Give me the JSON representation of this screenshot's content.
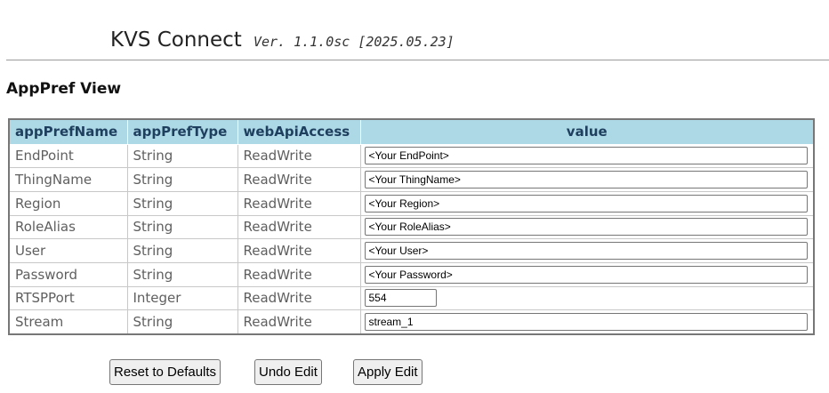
{
  "header": {
    "title": "KVS Connect",
    "version": "Ver. 1.1.0sc [2025.05.23]"
  },
  "view_title": "AppPref View",
  "table": {
    "columns": [
      "appPrefName",
      "appPrefType",
      "webApiAccess",
      "value"
    ],
    "rows": [
      {
        "name": "EndPoint",
        "type": "String",
        "access": "ReadWrite",
        "value": "<Your EndPoint>"
      },
      {
        "name": "ThingName",
        "type": "String",
        "access": "ReadWrite",
        "value": "<Your ThingName>"
      },
      {
        "name": "Region",
        "type": "String",
        "access": "ReadWrite",
        "value": "<Your Region>"
      },
      {
        "name": "RoleAlias",
        "type": "String",
        "access": "ReadWrite",
        "value": "<Your RoleAlias>"
      },
      {
        "name": "User",
        "type": "String",
        "access": "ReadWrite",
        "value": "<Your User>"
      },
      {
        "name": "Password",
        "type": "String",
        "access": "ReadWrite",
        "value": "<Your Password>"
      },
      {
        "name": "RTSPPort",
        "type": "Integer",
        "access": "ReadWrite",
        "value": "554"
      },
      {
        "name": "Stream",
        "type": "String",
        "access": "ReadWrite",
        "value": "stream_1"
      }
    ]
  },
  "buttons": {
    "reset": "Reset to Defaults",
    "undo": "Undo Edit",
    "apply": "Apply Edit"
  },
  "colors": {
    "header_bg": "#add8e6",
    "header_text": "#1f3f5f",
    "cell_text": "#5f5f5f"
  }
}
